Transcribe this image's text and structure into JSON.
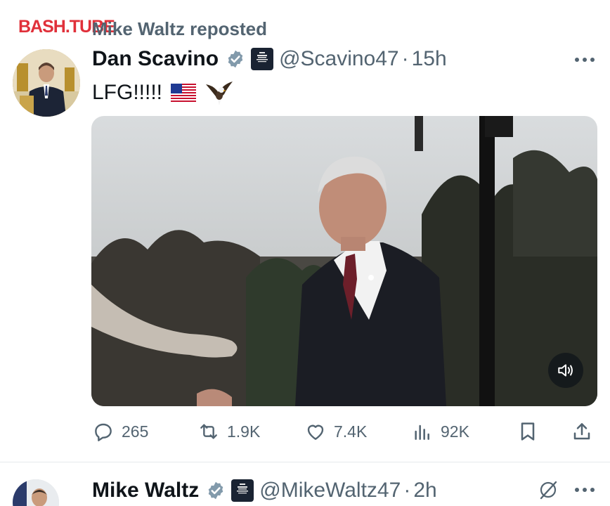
{
  "watermark": "BASH.TUBE",
  "repost_label": "Mike Waltz reposted",
  "tweet": {
    "author": "Dan Scavino",
    "handle": "@Scavino47",
    "separator": "·",
    "time": "15h",
    "text": "LFG!!!!!",
    "emojis": [
      "us-flag-emoji",
      "eagle-emoji"
    ],
    "media": {
      "type": "video",
      "muted": true
    },
    "stats": {
      "replies": "265",
      "reposts": "1.9K",
      "likes": "7.4K",
      "views": "92K"
    }
  },
  "next_tweet": {
    "author": "Mike Waltz",
    "handle": "@MikeWaltz47",
    "separator": "·",
    "time": "2h"
  },
  "colors": {
    "verified": "#829aab",
    "secondary_text": "#536471",
    "primary_text": "#0f1419",
    "watermark": "#e0303a"
  }
}
